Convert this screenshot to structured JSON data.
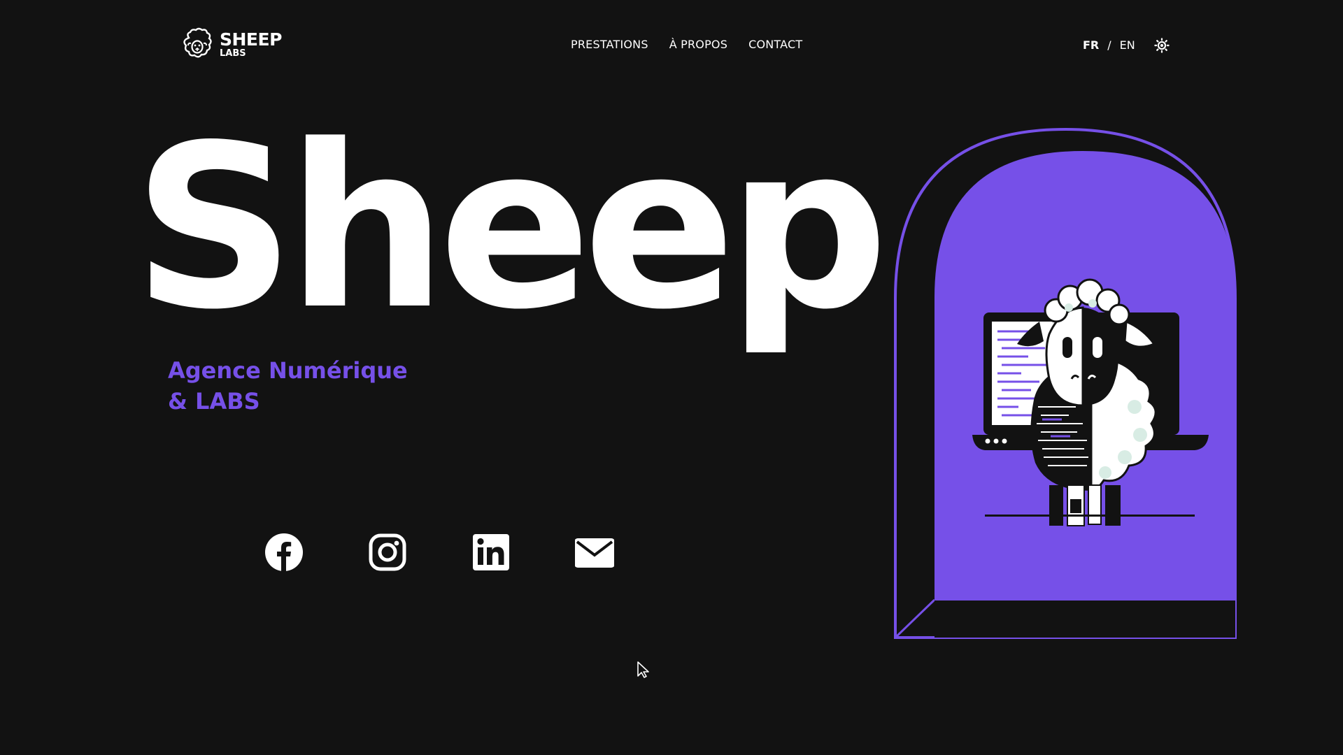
{
  "brand": {
    "name": "SHEEP",
    "sub": "LABS"
  },
  "nav": {
    "items": [
      {
        "label": "PRESTATIONS"
      },
      {
        "label": "À PROPOS"
      },
      {
        "label": "CONTACT"
      }
    ]
  },
  "lang": {
    "fr": "FR",
    "separator": "/",
    "en": "EN",
    "active": "FR"
  },
  "hero": {
    "title": "Sheep",
    "tagline_line1": "Agence Numérique",
    "tagline_line2": "& LABS"
  },
  "socials": [
    {
      "icon": "facebook-icon"
    },
    {
      "icon": "instagram-icon"
    },
    {
      "icon": "linkedin-icon"
    },
    {
      "icon": "mail-icon"
    }
  ],
  "colors": {
    "background": "#121212",
    "accent": "#7650e8",
    "text": "#ffffff"
  }
}
